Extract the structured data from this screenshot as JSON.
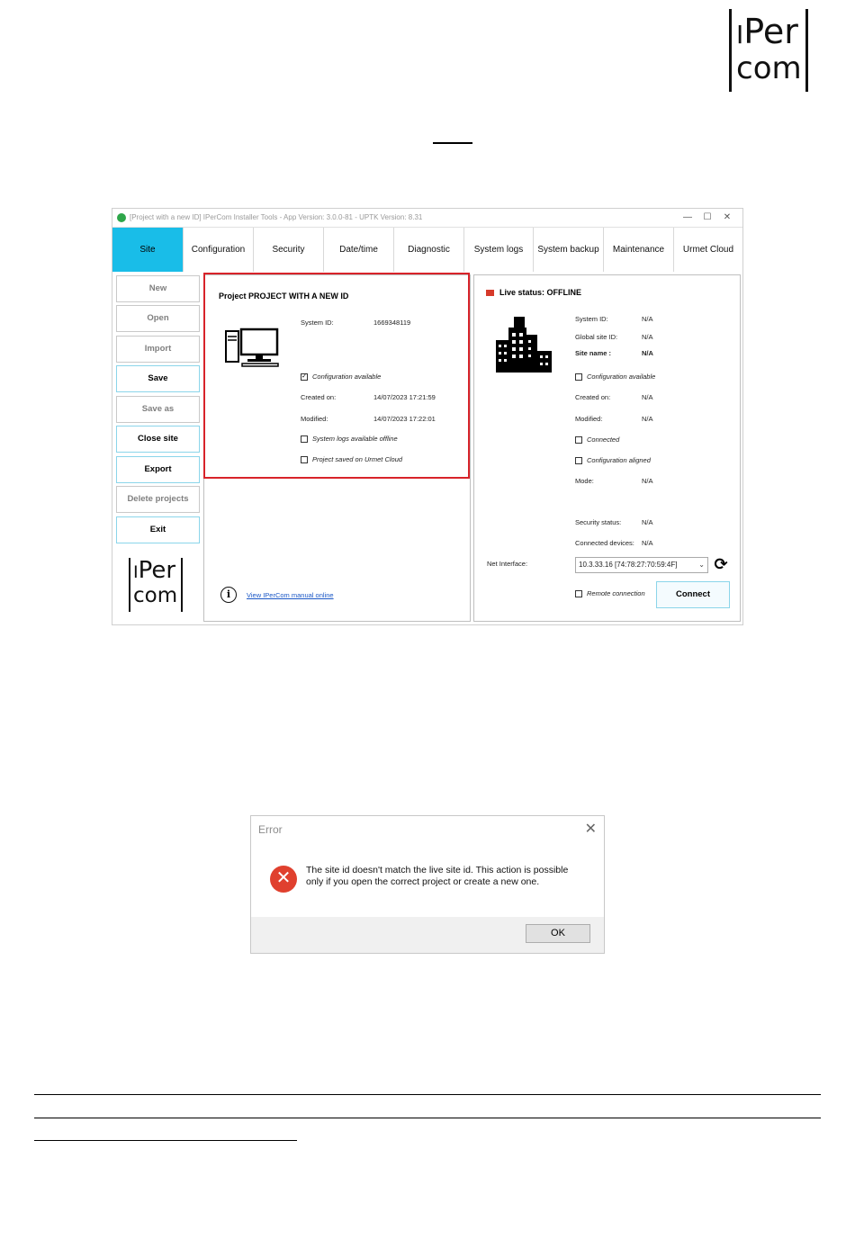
{
  "brand": {
    "logo_line1": "Per",
    "logo_line2": "com",
    "logo_prefix": "I"
  },
  "app": {
    "window_title": "[Project with a new ID] IPerCom Installer Tools - App Version: 3.0.0-81 - UPTK Version: 8.31",
    "window_buttons": [
      "—",
      "☐",
      "✕"
    ],
    "tabs": [
      "Site",
      "Configuration",
      "Security",
      "Date/time",
      "Diagnostic",
      "System logs",
      "System backup",
      "Maintenance",
      "Urmet Cloud"
    ],
    "active_tab": "Site",
    "side_buttons": [
      {
        "label": "New",
        "enabled": false
      },
      {
        "label": "Open",
        "enabled": false
      },
      {
        "label": "Import",
        "enabled": false
      },
      {
        "label": "Save",
        "enabled": true
      },
      {
        "label": "Save as",
        "enabled": false
      },
      {
        "label": "Close site",
        "enabled": true
      },
      {
        "label": "Export",
        "enabled": true
      },
      {
        "label": "Delete projects",
        "enabled": false
      },
      {
        "label": "Exit",
        "enabled": true
      }
    ],
    "project": {
      "title": "Project PROJECT WITH A NEW ID",
      "system_id_label": "System ID:",
      "system_id_value": "1669348119",
      "config_available": "Configuration available",
      "config_available_checked": true,
      "created_label": "Created on:",
      "created_value": "14/07/2023 17:21:59",
      "modified_label": "Modified:",
      "modified_value": "14/07/2023 17:22:01",
      "logs_offline": "System logs available offline",
      "saved_cloud": "Project saved on Urmet Cloud",
      "manual_link": "View IPerCom manual online"
    },
    "live": {
      "status": "Live status: OFFLINE",
      "status_color": "#d63a2a",
      "system_id_label": "System ID:",
      "global_site_label": "Global site ID:",
      "site_name_label": "Site name :",
      "na": "N/A",
      "config_available": "Configuration available",
      "created_label": "Created on:",
      "modified_label": "Modified:",
      "connected": "Connected",
      "config_aligned": "Configuration aligned",
      "mode_label": "Mode:",
      "security_label": "Security status:",
      "devices_label": "Connected devices:",
      "net_label": "Net Interface:",
      "net_value": "10.3.33.16 [74:78:27:70:59:4F]",
      "remote": "Remote connection",
      "connect": "Connect"
    }
  },
  "dialog": {
    "title": "Error",
    "message": "The site id doesn't match the live site id. This action is possible only if you open the correct project or create a new one.",
    "ok": "OK"
  },
  "colors": {
    "accent": "#19bde8",
    "highlight": "#d8232a",
    "error": "#e0402e"
  }
}
